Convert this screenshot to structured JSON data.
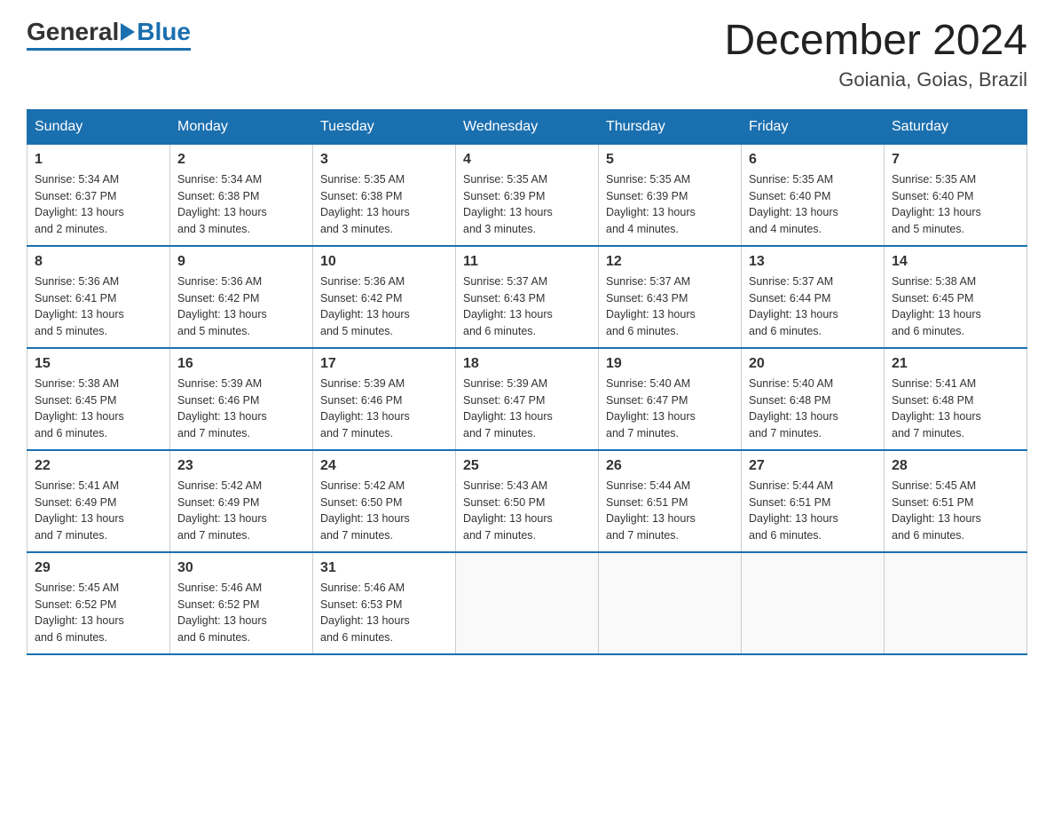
{
  "header": {
    "logo_general": "General",
    "logo_blue": "Blue",
    "month_title": "December 2024",
    "location": "Goiania, Goias, Brazil"
  },
  "days_of_week": [
    "Sunday",
    "Monday",
    "Tuesday",
    "Wednesday",
    "Thursday",
    "Friday",
    "Saturday"
  ],
  "weeks": [
    [
      {
        "day": "1",
        "sunrise": "5:34 AM",
        "sunset": "6:37 PM",
        "daylight": "13 hours and 2 minutes."
      },
      {
        "day": "2",
        "sunrise": "5:34 AM",
        "sunset": "6:38 PM",
        "daylight": "13 hours and 3 minutes."
      },
      {
        "day": "3",
        "sunrise": "5:35 AM",
        "sunset": "6:38 PM",
        "daylight": "13 hours and 3 minutes."
      },
      {
        "day": "4",
        "sunrise": "5:35 AM",
        "sunset": "6:39 PM",
        "daylight": "13 hours and 3 minutes."
      },
      {
        "day": "5",
        "sunrise": "5:35 AM",
        "sunset": "6:39 PM",
        "daylight": "13 hours and 4 minutes."
      },
      {
        "day": "6",
        "sunrise": "5:35 AM",
        "sunset": "6:40 PM",
        "daylight": "13 hours and 4 minutes."
      },
      {
        "day": "7",
        "sunrise": "5:35 AM",
        "sunset": "6:40 PM",
        "daylight": "13 hours and 5 minutes."
      }
    ],
    [
      {
        "day": "8",
        "sunrise": "5:36 AM",
        "sunset": "6:41 PM",
        "daylight": "13 hours and 5 minutes."
      },
      {
        "day": "9",
        "sunrise": "5:36 AM",
        "sunset": "6:42 PM",
        "daylight": "13 hours and 5 minutes."
      },
      {
        "day": "10",
        "sunrise": "5:36 AM",
        "sunset": "6:42 PM",
        "daylight": "13 hours and 5 minutes."
      },
      {
        "day": "11",
        "sunrise": "5:37 AM",
        "sunset": "6:43 PM",
        "daylight": "13 hours and 6 minutes."
      },
      {
        "day": "12",
        "sunrise": "5:37 AM",
        "sunset": "6:43 PM",
        "daylight": "13 hours and 6 minutes."
      },
      {
        "day": "13",
        "sunrise": "5:37 AM",
        "sunset": "6:44 PM",
        "daylight": "13 hours and 6 minutes."
      },
      {
        "day": "14",
        "sunrise": "5:38 AM",
        "sunset": "6:45 PM",
        "daylight": "13 hours and 6 minutes."
      }
    ],
    [
      {
        "day": "15",
        "sunrise": "5:38 AM",
        "sunset": "6:45 PM",
        "daylight": "13 hours and 6 minutes."
      },
      {
        "day": "16",
        "sunrise": "5:39 AM",
        "sunset": "6:46 PM",
        "daylight": "13 hours and 7 minutes."
      },
      {
        "day": "17",
        "sunrise": "5:39 AM",
        "sunset": "6:46 PM",
        "daylight": "13 hours and 7 minutes."
      },
      {
        "day": "18",
        "sunrise": "5:39 AM",
        "sunset": "6:47 PM",
        "daylight": "13 hours and 7 minutes."
      },
      {
        "day": "19",
        "sunrise": "5:40 AM",
        "sunset": "6:47 PM",
        "daylight": "13 hours and 7 minutes."
      },
      {
        "day": "20",
        "sunrise": "5:40 AM",
        "sunset": "6:48 PM",
        "daylight": "13 hours and 7 minutes."
      },
      {
        "day": "21",
        "sunrise": "5:41 AM",
        "sunset": "6:48 PM",
        "daylight": "13 hours and 7 minutes."
      }
    ],
    [
      {
        "day": "22",
        "sunrise": "5:41 AM",
        "sunset": "6:49 PM",
        "daylight": "13 hours and 7 minutes."
      },
      {
        "day": "23",
        "sunrise": "5:42 AM",
        "sunset": "6:49 PM",
        "daylight": "13 hours and 7 minutes."
      },
      {
        "day": "24",
        "sunrise": "5:42 AM",
        "sunset": "6:50 PM",
        "daylight": "13 hours and 7 minutes."
      },
      {
        "day": "25",
        "sunrise": "5:43 AM",
        "sunset": "6:50 PM",
        "daylight": "13 hours and 7 minutes."
      },
      {
        "day": "26",
        "sunrise": "5:44 AM",
        "sunset": "6:51 PM",
        "daylight": "13 hours and 7 minutes."
      },
      {
        "day": "27",
        "sunrise": "5:44 AM",
        "sunset": "6:51 PM",
        "daylight": "13 hours and 6 minutes."
      },
      {
        "day": "28",
        "sunrise": "5:45 AM",
        "sunset": "6:51 PM",
        "daylight": "13 hours and 6 minutes."
      }
    ],
    [
      {
        "day": "29",
        "sunrise": "5:45 AM",
        "sunset": "6:52 PM",
        "daylight": "13 hours and 6 minutes."
      },
      {
        "day": "30",
        "sunrise": "5:46 AM",
        "sunset": "6:52 PM",
        "daylight": "13 hours and 6 minutes."
      },
      {
        "day": "31",
        "sunrise": "5:46 AM",
        "sunset": "6:53 PM",
        "daylight": "13 hours and 6 minutes."
      },
      null,
      null,
      null,
      null
    ]
  ],
  "labels": {
    "sunrise": "Sunrise:",
    "sunset": "Sunset:",
    "daylight": "Daylight:"
  }
}
